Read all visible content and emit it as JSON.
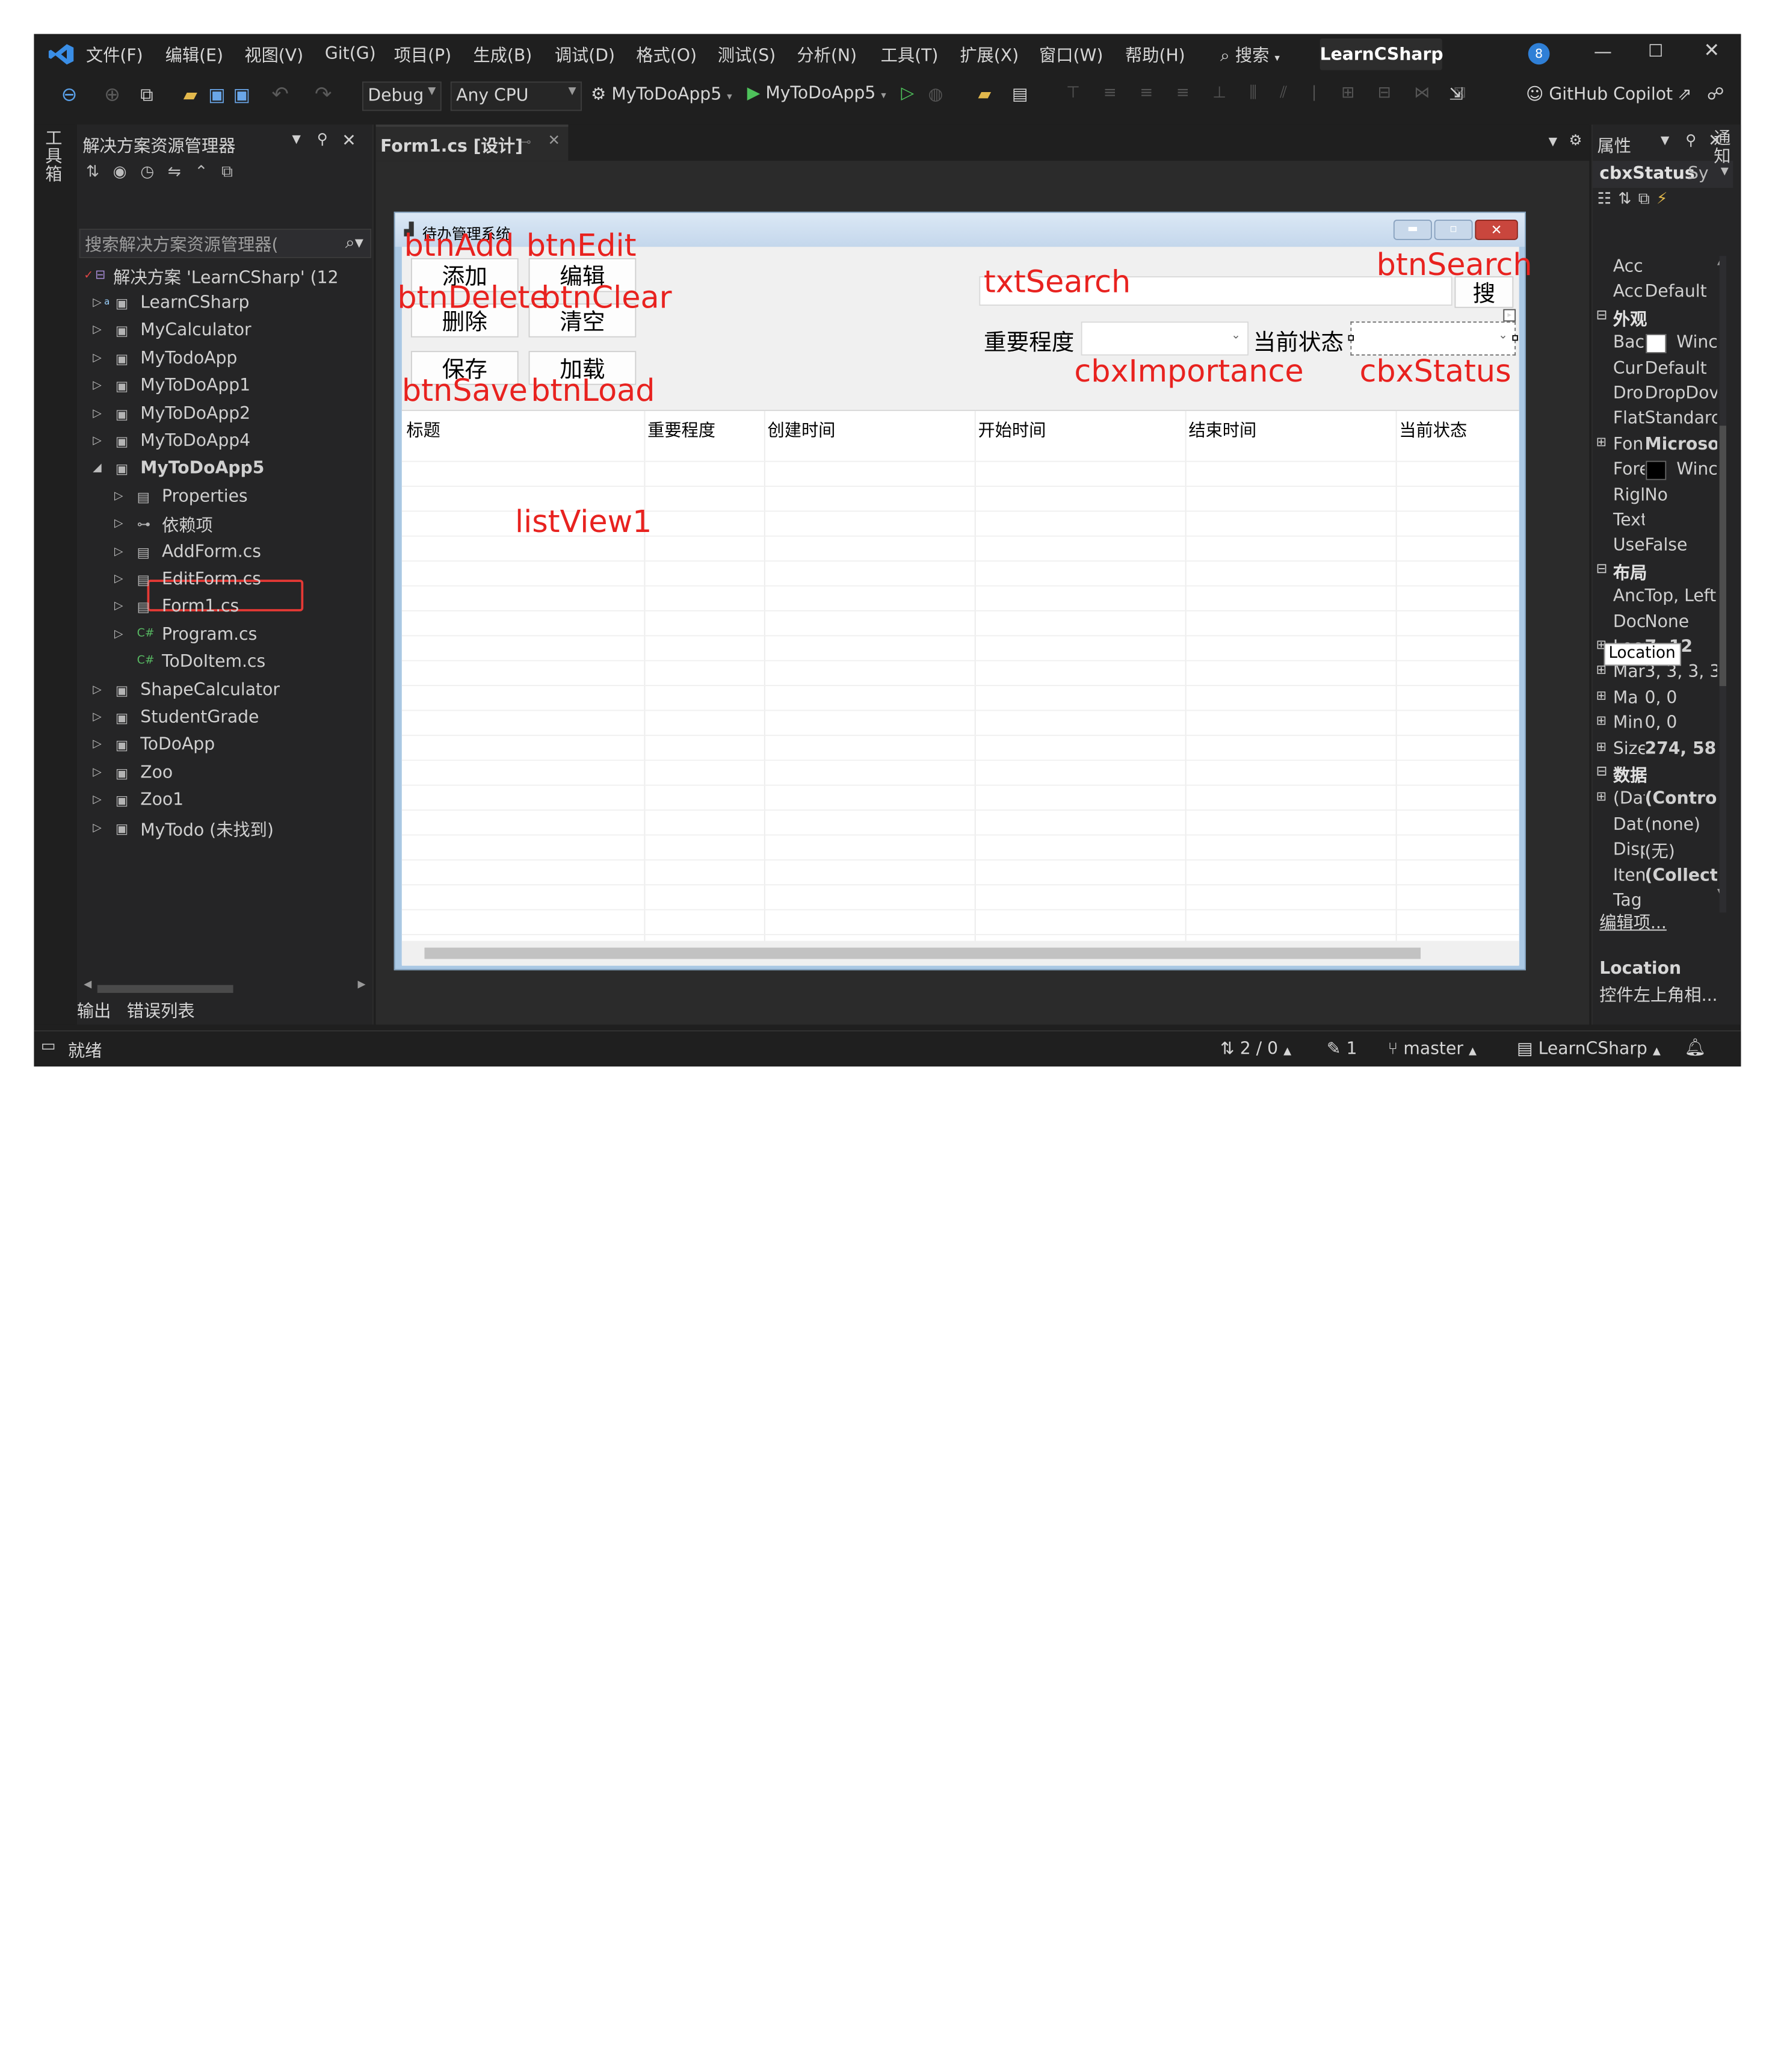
{
  "menus": [
    "文件(F)",
    "编辑(E)",
    "视图(V)",
    "Git(G)",
    "项目(P)",
    "生成(B)",
    "调试(D)",
    "格式(O)",
    "测试(S)",
    "分析(N)",
    "工具(T)",
    "扩展(X)",
    "窗口(W)",
    "帮助(H)"
  ],
  "search": {
    "label": "搜索"
  },
  "solution_name": "LearnCSharp",
  "notification_count": "8",
  "toolbar": {
    "config": "Debug",
    "platform": "Any CPU",
    "startup_project": "MyToDoApp5",
    "run_target": "MyToDoApp5",
    "copilot": "GitHub Copilot"
  },
  "left_strip": {
    "toolbox": "工具箱"
  },
  "right_strip": {
    "notifications": "通知"
  },
  "solution_explorer": {
    "title": "解决方案资源管理器",
    "search_placeholder": "搜索解决方案资源管理器(",
    "root": "解决方案 'LearnCSharp' (12",
    "items": [
      {
        "label": "LearnCSharp"
      },
      {
        "label": "MyCalculator"
      },
      {
        "label": "MyTodoApp"
      },
      {
        "label": "MyToDoApp1"
      },
      {
        "label": "MyToDoApp2"
      },
      {
        "label": "MyToDoApp4"
      },
      {
        "label": "MyToDoApp5"
      },
      {
        "label": "Properties"
      },
      {
        "label": "依赖项"
      },
      {
        "label": "AddForm.cs"
      },
      {
        "label": "EditForm.cs"
      },
      {
        "label": "Form1.cs"
      },
      {
        "label": "Program.cs"
      },
      {
        "label": "ToDoItem.cs"
      },
      {
        "label": "ShapeCalculator"
      },
      {
        "label": "StudentGrade"
      },
      {
        "label": "ToDoApp"
      },
      {
        "label": "Zoo"
      },
      {
        "label": "Zoo1"
      },
      {
        "label": "MyTodo (未找到)"
      }
    ]
  },
  "bottom_tabs": [
    "输出",
    "错误列表"
  ],
  "document_tab": {
    "title": "Form1.cs [设计]"
  },
  "form": {
    "title": "待办管理系统",
    "buttons": {
      "add": "添加",
      "edit": "编辑",
      "delete": "删除",
      "clear": "清空",
      "save": "保存",
      "load": "加载",
      "search": "搜"
    },
    "importance_label": "重要程度",
    "status_label": "当前状态",
    "columns": [
      "标题",
      "重要程度",
      "创建时间",
      "开始时间",
      "结束时间",
      "当前状态"
    ]
  },
  "annotations": {
    "btnAdd": "btnAdd",
    "btnEdit": "btnEdit",
    "btnDelete": "btnDelete",
    "btnClear": "btnClear",
    "btnSave": "btnSave",
    "btnLoad": "btnLoad",
    "txtSearch": "txtSearch",
    "btnSearch": "btnSearch",
    "cbxImportance": "cbxImportance",
    "cbxStatus": "cbxStatus",
    "listView1": "listView1"
  },
  "properties": {
    "title": "属性",
    "object": "cbxStatus",
    "object_type": "Sy",
    "rows": [
      {
        "kind": "prop",
        "name": "Acc",
        "value": ""
      },
      {
        "kind": "prop",
        "name": "Acc",
        "value": "Default"
      },
      {
        "kind": "cat",
        "name": "外观"
      },
      {
        "kind": "prop",
        "name": "Bac",
        "value": "Winc",
        "swatch": "#ffffff"
      },
      {
        "kind": "prop",
        "name": "Cur",
        "value": "Default"
      },
      {
        "kind": "prop",
        "name": "Dro",
        "value": "DropDov"
      },
      {
        "kind": "prop",
        "name": "Flat",
        "value": "Standarc"
      },
      {
        "kind": "prop",
        "name": "Fon",
        "value": "Microso",
        "bold": true,
        "expand": true
      },
      {
        "kind": "prop",
        "name": "Fore",
        "value": "Winc",
        "swatch": "#000000"
      },
      {
        "kind": "prop",
        "name": "Rigl",
        "value": "No"
      },
      {
        "kind": "prop",
        "name": "Text",
        "value": ""
      },
      {
        "kind": "prop",
        "name": "Use",
        "value": "False"
      },
      {
        "kind": "cat",
        "name": "布局"
      },
      {
        "kind": "prop",
        "name": "Anc",
        "value": "Top, Left"
      },
      {
        "kind": "prop",
        "name": "Doc",
        "value": "None"
      },
      {
        "kind": "prop",
        "name": "Location",
        "value": "7, 12",
        "bold": true,
        "expand": true
      },
      {
        "kind": "prop",
        "name": "Mar",
        "value": "3, 3, 3, 3",
        "expand": true
      },
      {
        "kind": "prop",
        "name": "Ma",
        "value": "0, 0",
        "expand": true
      },
      {
        "kind": "prop",
        "name": "Min",
        "value": "0, 0",
        "expand": true
      },
      {
        "kind": "prop",
        "name": "Size",
        "value": "274, 58",
        "bold": true,
        "expand": true
      },
      {
        "kind": "cat",
        "name": "数据"
      },
      {
        "kind": "prop",
        "name": "(Dat",
        "value": "(Control",
        "bold": true,
        "expand": true
      },
      {
        "kind": "prop",
        "name": "Dat",
        "value": "(none)"
      },
      {
        "kind": "prop",
        "name": "Disp",
        "value": "(无)"
      },
      {
        "kind": "prop",
        "name": "Iten",
        "value": "(Collecti",
        "bold": true
      },
      {
        "kind": "prop",
        "name": "Tag",
        "value": ""
      }
    ],
    "tooltip": "Location",
    "edit_items_link": "编辑项...",
    "desc_title": "Location",
    "desc_text": "控件左上角相..."
  },
  "status_bar": {
    "ready": "就绪",
    "sync": "2 / 0",
    "changes": "1",
    "branch": "master",
    "repo": "LearnCSharp"
  }
}
